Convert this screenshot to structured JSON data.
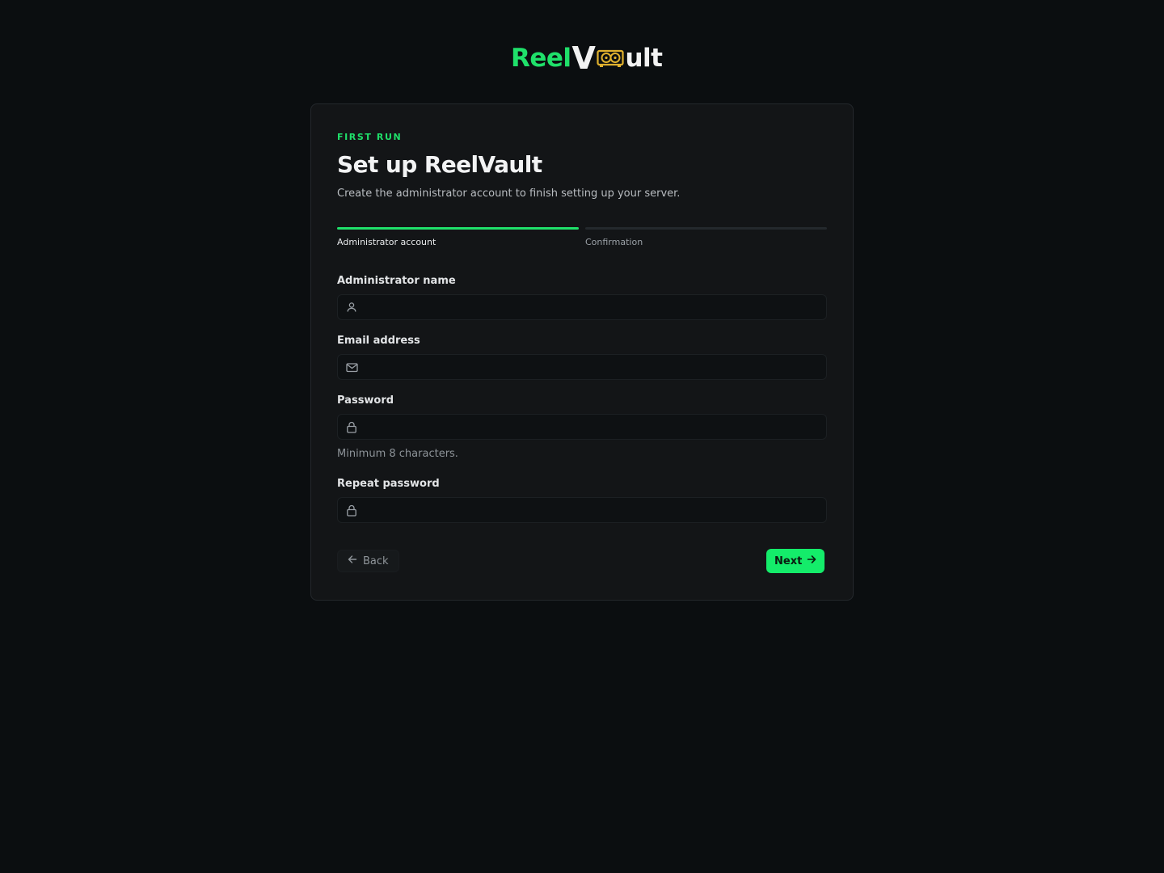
{
  "brand": {
    "part1": "Reel",
    "part2": "V",
    "part3": "ult",
    "accent_color": "#1fe06a",
    "emblem_color": "#e0b12e"
  },
  "card": {
    "eyebrow": "FIRST RUN",
    "title": "Set up ReelVault",
    "subtitle": "Create the administrator account to finish setting up your server."
  },
  "stepper": {
    "steps": [
      {
        "label": "Administrator account",
        "state": "active"
      },
      {
        "label": "Confirmation",
        "state": "pending"
      }
    ]
  },
  "form": {
    "admin_name": {
      "label": "Administrator name",
      "value": "",
      "icon": "user-icon"
    },
    "email": {
      "label": "Email address",
      "value": "",
      "icon": "mail-icon"
    },
    "password": {
      "label": "Password",
      "value": "",
      "icon": "lock-icon",
      "hint": "Minimum 8 characters."
    },
    "repeat_password": {
      "label": "Repeat password",
      "value": "",
      "icon": "lock-icon"
    }
  },
  "actions": {
    "back_label": "Back",
    "next_label": "Next"
  }
}
